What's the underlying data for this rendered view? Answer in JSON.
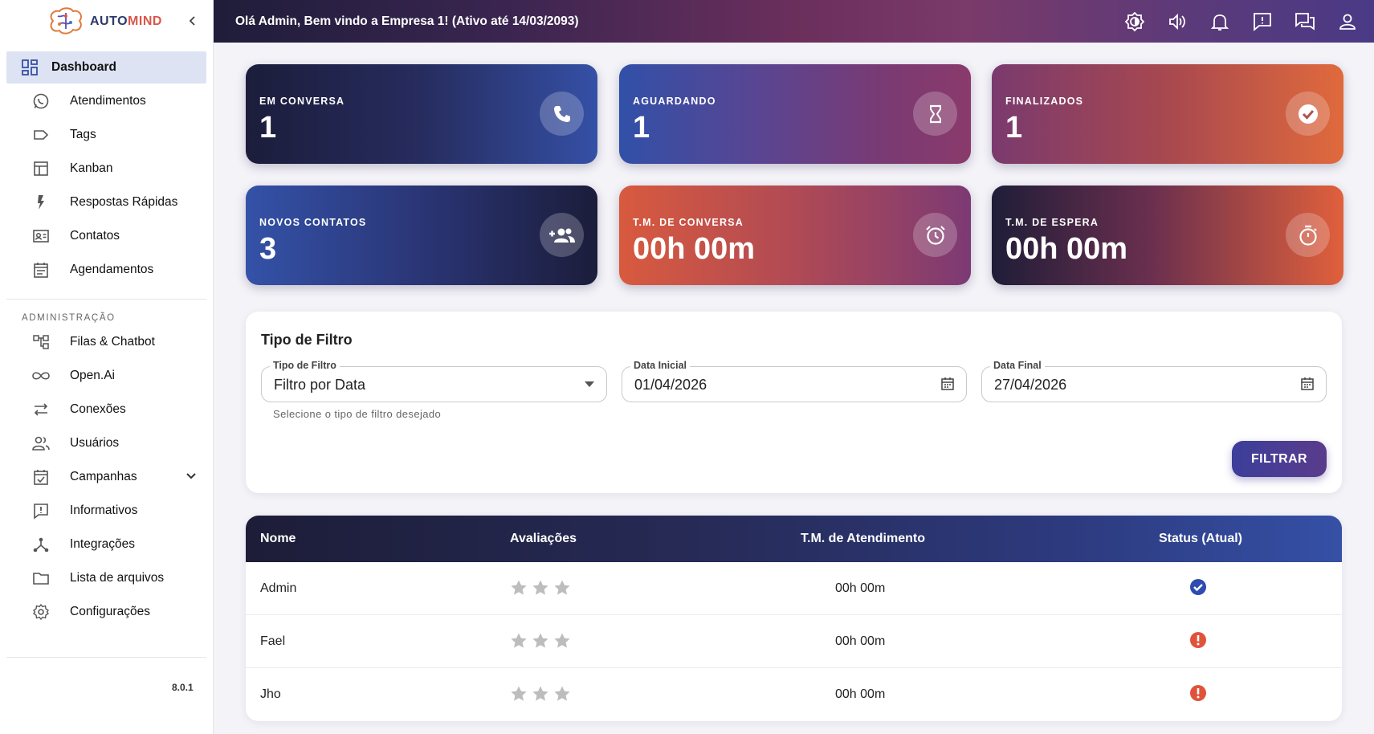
{
  "sidebar": {
    "logo_text_a": "AUTO",
    "logo_text_b": "MIND",
    "items": [
      {
        "label": "Dashboard",
        "icon": "dashboard-icon"
      },
      {
        "label": "Atendimentos",
        "icon": "whatsapp-icon"
      },
      {
        "label": "Tags",
        "icon": "tag-icon"
      },
      {
        "label": "Kanban",
        "icon": "kanban-icon"
      },
      {
        "label": "Respostas Rápidas",
        "icon": "flash-icon"
      },
      {
        "label": "Contatos",
        "icon": "contacts-icon"
      },
      {
        "label": "Agendamentos",
        "icon": "calendar-icon"
      }
    ],
    "section_title": "ADMINISTRAÇÃO",
    "admin_items": [
      {
        "label": "Filas & Chatbot",
        "icon": "queue-icon"
      },
      {
        "label": "Open.Ai",
        "icon": "infinity-icon"
      },
      {
        "label": "Conexões",
        "icon": "swap-icon"
      },
      {
        "label": "Usuários",
        "icon": "users-icon"
      },
      {
        "label": "Campanhas",
        "icon": "campaign-icon"
      },
      {
        "label": "Informativos",
        "icon": "announcement-icon"
      },
      {
        "label": "Integrações",
        "icon": "integration-icon"
      },
      {
        "label": "Lista de arquivos",
        "icon": "folder-icon"
      },
      {
        "label": "Configurações",
        "icon": "settings-icon"
      }
    ],
    "version": "8.0.1"
  },
  "topbar": {
    "greeting": "Olá Admin, Bem vindo a Empresa 1! (Ativo até 14/03/2093)"
  },
  "cards": [
    {
      "title": "EM CONVERSA",
      "value": "1",
      "icon": "phone-icon"
    },
    {
      "title": "AGUARDANDO",
      "value": "1",
      "icon": "hourglass-icon"
    },
    {
      "title": "FINALIZADOS",
      "value": "1",
      "icon": "check-circle-icon"
    },
    {
      "title": "NOVOS CONTATOS",
      "value": "3",
      "icon": "group-add-icon"
    },
    {
      "title": "T.M. DE CONVERSA",
      "value": "00h 00m",
      "icon": "alarm-icon"
    },
    {
      "title": "T.M. DE ESPERA",
      "value": "00h 00m",
      "icon": "timer-icon"
    }
  ],
  "filter": {
    "title": "Tipo de Filtro",
    "type_label": "Tipo de Filtro",
    "type_value": "Filtro por Data",
    "helper": "Selecione o tipo de filtro desejado",
    "start_label": "Data Inicial",
    "start_value": "01/04/2026",
    "end_label": "Data Final",
    "end_value": "27/04/2026",
    "button": "FILTRAR"
  },
  "table": {
    "headers": [
      "Nome",
      "Avaliações",
      "T.M. de Atendimento",
      "Status (Atual)"
    ],
    "rows": [
      {
        "name": "Admin",
        "rating": 0,
        "tm": "00h 00m",
        "status": "online"
      },
      {
        "name": "Fael",
        "rating": 0,
        "tm": "00h 00m",
        "status": "offline"
      },
      {
        "name": "Jho",
        "rating": 0,
        "tm": "00h 00m",
        "status": "offline"
      }
    ]
  },
  "colors": {
    "status_online": "#2d4bb0",
    "status_offline": "#e0533a",
    "star_empty": "#bdbdbd"
  }
}
